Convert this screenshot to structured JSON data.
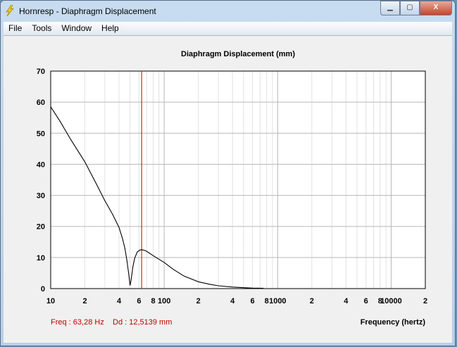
{
  "window": {
    "title": "Hornresp - Diaphragm Displacement",
    "minimize": "▁",
    "maximize": "▢",
    "close": "X"
  },
  "menu": [
    "File",
    "Tools",
    "Window",
    "Help"
  ],
  "readout": {
    "freq": "Freq : 63,28 Hz",
    "dd": "Dd : 12,5139 mm",
    "color": "#c00000"
  },
  "chart_data": {
    "type": "line",
    "title": "Diaphragm Displacement (mm)",
    "xlabel": "Frequency (hertz)",
    "ylabel": "",
    "xscale": "log",
    "xlim": [
      10,
      20000
    ],
    "ylim": [
      0,
      70
    ],
    "yticks": [
      "0",
      "10",
      "20",
      "30",
      "40",
      "50",
      "60",
      "70"
    ],
    "xticks": [
      {
        "v": 10,
        "l": "10"
      },
      {
        "v": 20,
        "l": "2"
      },
      {
        "v": 40,
        "l": "4"
      },
      {
        "v": 60,
        "l": "6"
      },
      {
        "v": 80,
        "l": "8"
      },
      {
        "v": 100,
        "l": "100"
      },
      {
        "v": 200,
        "l": "2"
      },
      {
        "v": 400,
        "l": "4"
      },
      {
        "v": 600,
        "l": "6"
      },
      {
        "v": 800,
        "l": "8"
      },
      {
        "v": 1000,
        "l": "1000"
      },
      {
        "v": 2000,
        "l": "2"
      },
      {
        "v": 4000,
        "l": "4"
      },
      {
        "v": 6000,
        "l": "6"
      },
      {
        "v": 8000,
        "l": "8"
      },
      {
        "v": 10000,
        "l": "10000"
      },
      {
        "v": 20000,
        "l": "2"
      }
    ],
    "cursor_freq": 63.28,
    "series": [
      {
        "name": "Displacement",
        "color": "#000000",
        "x": [
          10,
          12,
          15,
          20,
          25,
          30,
          35,
          40,
          43,
          45,
          47,
          49,
          50,
          51,
          53,
          55,
          58,
          61,
          63,
          66,
          70,
          80,
          100,
          120,
          150,
          200,
          250,
          300,
          400,
          500,
          600,
          750
        ],
        "y": [
          58.5,
          54,
          48,
          40.8,
          34,
          28.3,
          24,
          19.7,
          16,
          13,
          9,
          4,
          1,
          2.5,
          7,
          9.8,
          11.8,
          12.4,
          12.5,
          12.4,
          12,
          10.6,
          8.4,
          6.2,
          4,
          2.2,
          1.4,
          0.9,
          0.5,
          0.3,
          0.15,
          0.1
        ]
      }
    ]
  }
}
